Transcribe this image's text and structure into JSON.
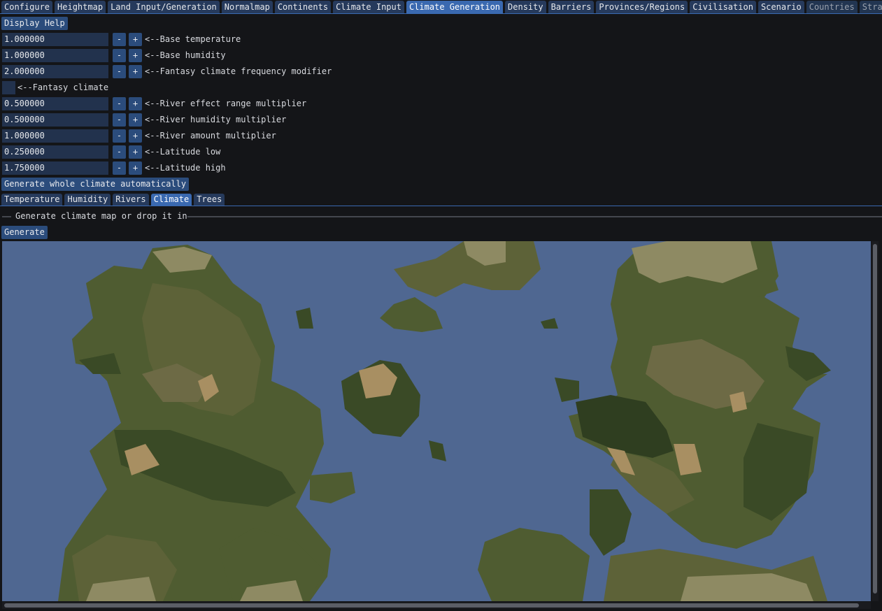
{
  "main_tabs": [
    {
      "label": "Configure",
      "state": "normal"
    },
    {
      "label": "Heightmap",
      "state": "normal"
    },
    {
      "label": "Land Input/Generation",
      "state": "normal"
    },
    {
      "label": "Normalmap",
      "state": "normal"
    },
    {
      "label": "Continents",
      "state": "normal"
    },
    {
      "label": "Climate Input",
      "state": "normal"
    },
    {
      "label": "Climate Generation",
      "state": "active"
    },
    {
      "label": "Density",
      "state": "normal"
    },
    {
      "label": "Barriers",
      "state": "normal"
    },
    {
      "label": "Provinces/Regions",
      "state": "normal"
    },
    {
      "label": "Civilisation",
      "state": "normal"
    },
    {
      "label": "Scenario",
      "state": "normal"
    },
    {
      "label": "Countries",
      "state": "dim"
    },
    {
      "label": "Strat",
      "state": "dim"
    }
  ],
  "display_help_label": "Display Help",
  "params": [
    {
      "value": "1.000000",
      "label": "<--Base temperature"
    },
    {
      "value": "1.000000",
      "label": "<--Base humidity"
    },
    {
      "value": "2.000000",
      "label": "<--Fantasy climate frequency modifier"
    }
  ],
  "fantasy_climate": {
    "label": "<--Fantasy climate",
    "checked": false
  },
  "params2": [
    {
      "value": "0.500000",
      "label": "<--River effect range multiplier"
    },
    {
      "value": "0.500000",
      "label": "<--River humidity multiplier"
    },
    {
      "value": "1.000000",
      "label": "<--River amount multiplier"
    },
    {
      "value": "0.250000",
      "label": "<--Latitude low"
    },
    {
      "value": "1.750000",
      "label": "<--Latitude high"
    }
  ],
  "stepper": {
    "minus": "-",
    "plus": "+"
  },
  "generate_all_label": "Generate whole climate automatically",
  "sub_tabs": [
    {
      "label": "Temperature",
      "active": false
    },
    {
      "label": "Humidity",
      "active": false
    },
    {
      "label": "Rivers",
      "active": false
    },
    {
      "label": "Climate",
      "active": true
    },
    {
      "label": "Trees",
      "active": false
    }
  ],
  "section_title": "Generate climate map or drop it in",
  "generate_label": "Generate",
  "colors": {
    "accent": "#3a69b0",
    "ocean": "#4f6791",
    "forest_dark": "#3a4a26",
    "forest": "#4f5c31",
    "grass": "#5d6238",
    "dry": "#6d6a45",
    "desert": "#a88f62",
    "tundra": "#8e8a63"
  }
}
